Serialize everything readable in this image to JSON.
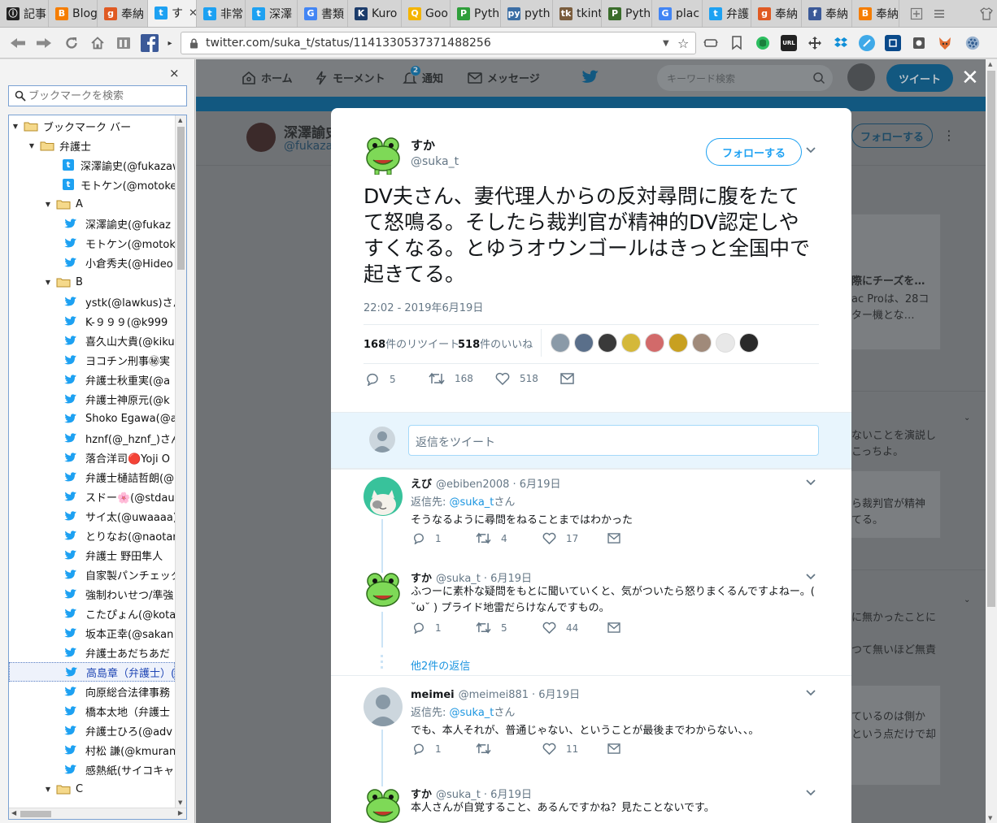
{
  "tabs": [
    {
      "label": "記事",
      "color": "#222222",
      "glyph": "ⓘ"
    },
    {
      "label": "Blog",
      "color": "#f57d00",
      "glyph": "B"
    },
    {
      "label": "奉納",
      "color": "#e05a23",
      "glyph": "g"
    },
    {
      "label": "す",
      "color": "#1da1f2",
      "glyph": "t",
      "active": true
    },
    {
      "label": "非常",
      "color": "#1da1f2",
      "glyph": "t"
    },
    {
      "label": "深澤",
      "color": "#1da1f2",
      "glyph": "t"
    },
    {
      "label": "書類",
      "color": "#4285f4",
      "glyph": "G"
    },
    {
      "label": "Kuro",
      "color": "#1c3c6b",
      "glyph": "K"
    },
    {
      "label": "Goo",
      "color": "#f4b400",
      "glyph": "Q"
    },
    {
      "label": "Pyth",
      "color": "#2e9e3a",
      "glyph": "P"
    },
    {
      "label": "pyth",
      "color": "#3b6ea5",
      "glyph": "py"
    },
    {
      "label": "tkint",
      "color": "#7a5c3c",
      "glyph": "tk"
    },
    {
      "label": "Pyth",
      "color": "#3a6d2b",
      "glyph": "P"
    },
    {
      "label": "plac",
      "color": "#4285f4",
      "glyph": "G"
    },
    {
      "label": "弁護",
      "color": "#1da1f2",
      "glyph": "t"
    },
    {
      "label": "奉納",
      "color": "#e05a23",
      "glyph": "g"
    },
    {
      "label": "奉納",
      "color": "#3b5998",
      "glyph": "f"
    },
    {
      "label": "奉納",
      "color": "#f57d00",
      "glyph": "B"
    }
  ],
  "address": {
    "url": "twitter.com/suka_t/status/1141330537371488256"
  },
  "sidebar": {
    "search_placeholder": "ブックマークを検索",
    "close": "×",
    "tree": [
      {
        "label": "ブックマーク バー",
        "type": "folder",
        "level": 0
      },
      {
        "label": "弁護士",
        "type": "folder",
        "level": 1
      },
      {
        "label": "深澤諭史(@fukazawa",
        "type": "twfav",
        "level": 2
      },
      {
        "label": "モトケン(@motoken_",
        "type": "twfav",
        "level": 2
      },
      {
        "label": "A",
        "type": "folder",
        "level": 2
      },
      {
        "label": "深澤諭史(@fukaz",
        "type": "bird",
        "level": 3
      },
      {
        "label": "モトケン(@motok",
        "type": "bird",
        "level": 3
      },
      {
        "label": "小倉秀夫(@Hideo",
        "type": "bird",
        "level": 3
      },
      {
        "label": "B",
        "type": "folder",
        "level": 2
      },
      {
        "label": "ystk(@lawkus)さん",
        "type": "bird",
        "level": 3
      },
      {
        "label": "K-９９９(@k999",
        "type": "bird",
        "level": 3
      },
      {
        "label": "喜久山大貴(@kiku",
        "type": "bird",
        "level": 3
      },
      {
        "label": "ヨコチン刑事㊙実",
        "type": "bird",
        "level": 3
      },
      {
        "label": "弁護士秋重実(@a",
        "type": "bird",
        "level": 3
      },
      {
        "label": "弁護士神原元(@k",
        "type": "bird",
        "level": 3
      },
      {
        "label": "Shoko Egawa(@a",
        "type": "bird",
        "level": 3
      },
      {
        "label": "hznf(@_hznf_)さん",
        "type": "bird",
        "level": 3
      },
      {
        "label": "落合洋司🔴Yoji O",
        "type": "bird",
        "level": 3
      },
      {
        "label": "弁護士樋詰哲朗(@",
        "type": "bird",
        "level": 3
      },
      {
        "label": "スドー🌸(@stdau",
        "type": "bird",
        "level": 3
      },
      {
        "label": "サイ太(@uwaaaa)",
        "type": "bird",
        "level": 3
      },
      {
        "label": "とりなお(@naotar",
        "type": "bird",
        "level": 3
      },
      {
        "label": "弁護士 野田隼人",
        "type": "bird",
        "level": 3
      },
      {
        "label": "自家製パンチェック",
        "type": "bird",
        "level": 3
      },
      {
        "label": "強制わいせつ/準強",
        "type": "bird",
        "level": 3
      },
      {
        "label": "こたぴょん(@kota",
        "type": "bird",
        "level": 3
      },
      {
        "label": "坂本正幸(@sakan",
        "type": "bird",
        "level": 3
      },
      {
        "label": "弁護士あだちあだ",
        "type": "bird",
        "level": 3
      },
      {
        "label": "高島章（弁護士）(@",
        "type": "bird",
        "level": 3,
        "selected": true
      },
      {
        "label": "向原総合法律事務",
        "type": "bird",
        "level": 3
      },
      {
        "label": "橋本太地（弁護士",
        "type": "bird",
        "level": 3
      },
      {
        "label": "弁護士ひろ(@adv",
        "type": "bird",
        "level": 3
      },
      {
        "label": "村松 謙(@kmuran",
        "type": "bird",
        "level": 3
      },
      {
        "label": "感熱紙(サイコキャ",
        "type": "bird",
        "level": 3
      },
      {
        "label": "C",
        "type": "folder",
        "level": 2
      }
    ]
  },
  "twitter_nav": {
    "home": "ホーム",
    "moments": "モーメント",
    "notifications": "通知",
    "notif_count": "2",
    "messages": "メッセージ",
    "search_placeholder": "キーワード検索",
    "tweet_button": "ツイート"
  },
  "background": {
    "profile_name": "深澤諭史",
    "profile_handle": "@fukazaw",
    "follow": "フォローする",
    "snippets": [
      "際にチーズを…",
      "ac Proは、28コ",
      "ター機とな…",
      "ないことを演説し",
      "こっちよ。",
      "ら裁判官が精神",
      "てる。",
      "に無かったことに",
      "つて無いほど無責",
      "ているのは側か",
      "という点だけで却"
    ]
  },
  "tweet": {
    "name": "すか",
    "handle": "@suka_t",
    "follow_button": "フォローする",
    "text": "DV夫さん、妻代理人からの反対尋問に腹をたてて怒鳴る。そしたら裁判官が精神的DV認定しやすくなる。とゆうオウンゴールはきっと全国中で起きてる。",
    "timestamp": "22:02 - 2019年6月19日",
    "retweet_count": "168",
    "retweet_label": "件のリツイート",
    "like_count": "518",
    "like_label": "件のいいね",
    "reply_count": "5",
    "rt_count": "168",
    "fav_count": "518",
    "liker_colors": [
      "#8a9aa8",
      "#5a6f8a",
      "#3a3a3a",
      "#d4b83a",
      "#d26a6a",
      "#c8a020",
      "#a08a7a",
      "#e8e8e8",
      "#2a2a2a"
    ]
  },
  "reply_box": {
    "placeholder": "返信をツイート"
  },
  "replies": [
    {
      "name": "えび",
      "handle": "@ebiben2008",
      "date": "· 6月19日",
      "reply_to_prefix": "返信先: ",
      "reply_to": "@suka_t",
      "reply_to_suffix": "さん",
      "text": "そうなるように尋問をねることまではわかった",
      "replies": "1",
      "retweets": "4",
      "likes": "17"
    },
    {
      "name": "すか",
      "handle": "@suka_t",
      "date": "· 6月19日",
      "text": "ふつーに素朴な疑問をもとに聞いていくと、気がついたら怒りまくるんですよねー。( ˘ω˘ )  プライド地雷だらけなんですもの。",
      "replies": "1",
      "retweets": "5",
      "likes": "44"
    },
    {
      "more": "他2件の返信"
    },
    {
      "name": "meimei",
      "handle": "@meimei881",
      "date": "· 6月19日",
      "reply_to_prefix": "返信先: ",
      "reply_to": "@suka_t",
      "reply_to_suffix": "さん",
      "text": "でも、本人それが、普通じゃない、ということが最後までわからない、、。",
      "replies": "1",
      "retweets": "",
      "likes": "11"
    },
    {
      "name": "すか",
      "handle": "@suka_t",
      "date": "· 6月19日",
      "text": "本人さんが自覚すること、あるんですかね？見たことないです。"
    }
  ]
}
